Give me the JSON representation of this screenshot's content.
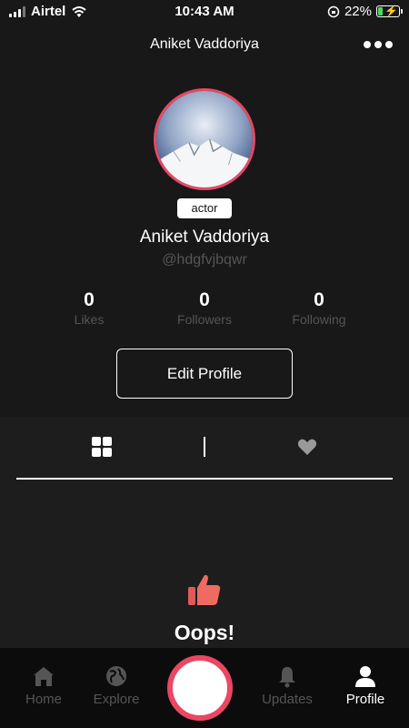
{
  "status_bar": {
    "carrier": "Airtel",
    "time": "10:43 AM",
    "battery": "22%",
    "battery_level": 0.22
  },
  "header": {
    "title": "Aniket Vaddoriya"
  },
  "profile": {
    "role": "actor",
    "name": "Aniket Vaddoriya",
    "handle": "@hdgfvjbqwr",
    "stats": [
      {
        "value": "0",
        "label": "Likes"
      },
      {
        "value": "0",
        "label": "Followers"
      },
      {
        "value": "0",
        "label": "Following"
      }
    ],
    "edit_label": "Edit Profile"
  },
  "tabs": [
    {
      "icon": "grid-icon",
      "active": true
    },
    {
      "icon": "heart-icon",
      "active": false
    }
  ],
  "empty_state": {
    "icon": "thumbs-up-icon",
    "title": "Oops!"
  },
  "bottom_nav": {
    "items": [
      {
        "label": "Home",
        "icon": "home-icon"
      },
      {
        "label": "Explore",
        "icon": "globe-icon"
      },
      {
        "label": "Updates",
        "icon": "bell-icon"
      },
      {
        "label": "Profile",
        "icon": "user-icon"
      }
    ],
    "active": "Profile"
  },
  "colors": {
    "accent": "#e94763",
    "background": "#181818",
    "muted": "#555555"
  }
}
